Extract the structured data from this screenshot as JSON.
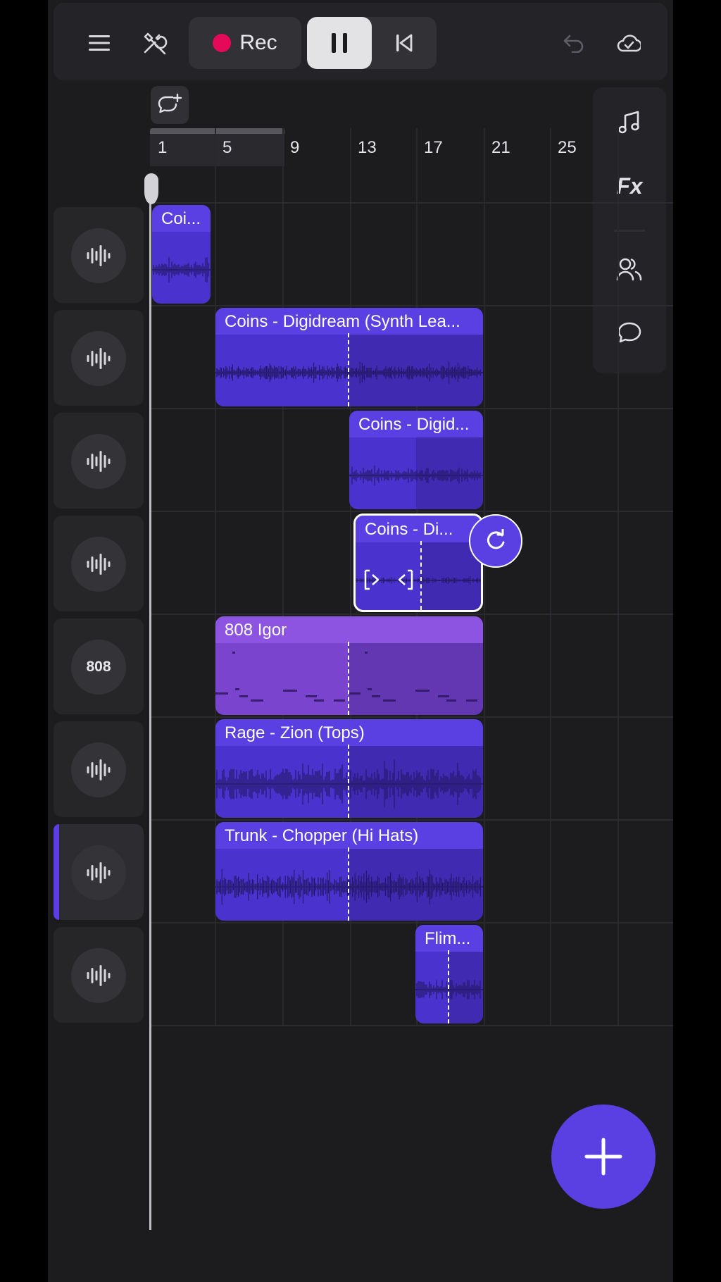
{
  "toolbar": {
    "menu_icon": "hamburger-icon",
    "tools_icon": "wrench-screwdriver-icon",
    "rec_label": "Rec",
    "rec_color": "#e5095a",
    "pause_icon": "pause-icon",
    "rewind_icon": "skip-to-start-icon",
    "undo_icon": "undo-icon",
    "save_icon": "cloud-check-icon"
  },
  "side_panel": {
    "items": [
      {
        "icon": "music-note-icon"
      },
      {
        "label": "Fx"
      },
      {
        "icon": "collaborators-icon"
      },
      {
        "icon": "chat-bubble-icon"
      }
    ]
  },
  "ruler": {
    "ticks": [
      "1",
      "5",
      "9",
      "13",
      "17",
      "21",
      "25"
    ]
  },
  "tracks": [
    {
      "type": "audio",
      "icon": "waveform-icon"
    },
    {
      "type": "audio",
      "icon": "waveform-icon"
    },
    {
      "type": "audio",
      "icon": "waveform-icon"
    },
    {
      "type": "audio",
      "icon": "waveform-icon"
    },
    {
      "type": "instrument",
      "label": "808"
    },
    {
      "type": "audio",
      "icon": "waveform-icon"
    },
    {
      "type": "audio",
      "icon": "waveform-icon",
      "selected": true
    },
    {
      "type": "audio",
      "icon": "waveform-icon"
    }
  ],
  "clips": [
    {
      "title": "Coi..."
    },
    {
      "title": "Coins - Digidream (Synth Lea..."
    },
    {
      "title": "Coins - Digid..."
    },
    {
      "title": "Coins - Di..."
    },
    {
      "title": "808 Igor"
    },
    {
      "title": "Rage - Zion (Tops)"
    },
    {
      "title": "Trunk - Chopper (Hi Hats)"
    },
    {
      "title": "Flim..."
    }
  ],
  "colors": {
    "accent": "#5a3fe2",
    "audio_clip": "#4a32cf",
    "midi_clip": "#8d54e2",
    "background": "#1c1c1f"
  },
  "fab_icon": "plus-icon"
}
